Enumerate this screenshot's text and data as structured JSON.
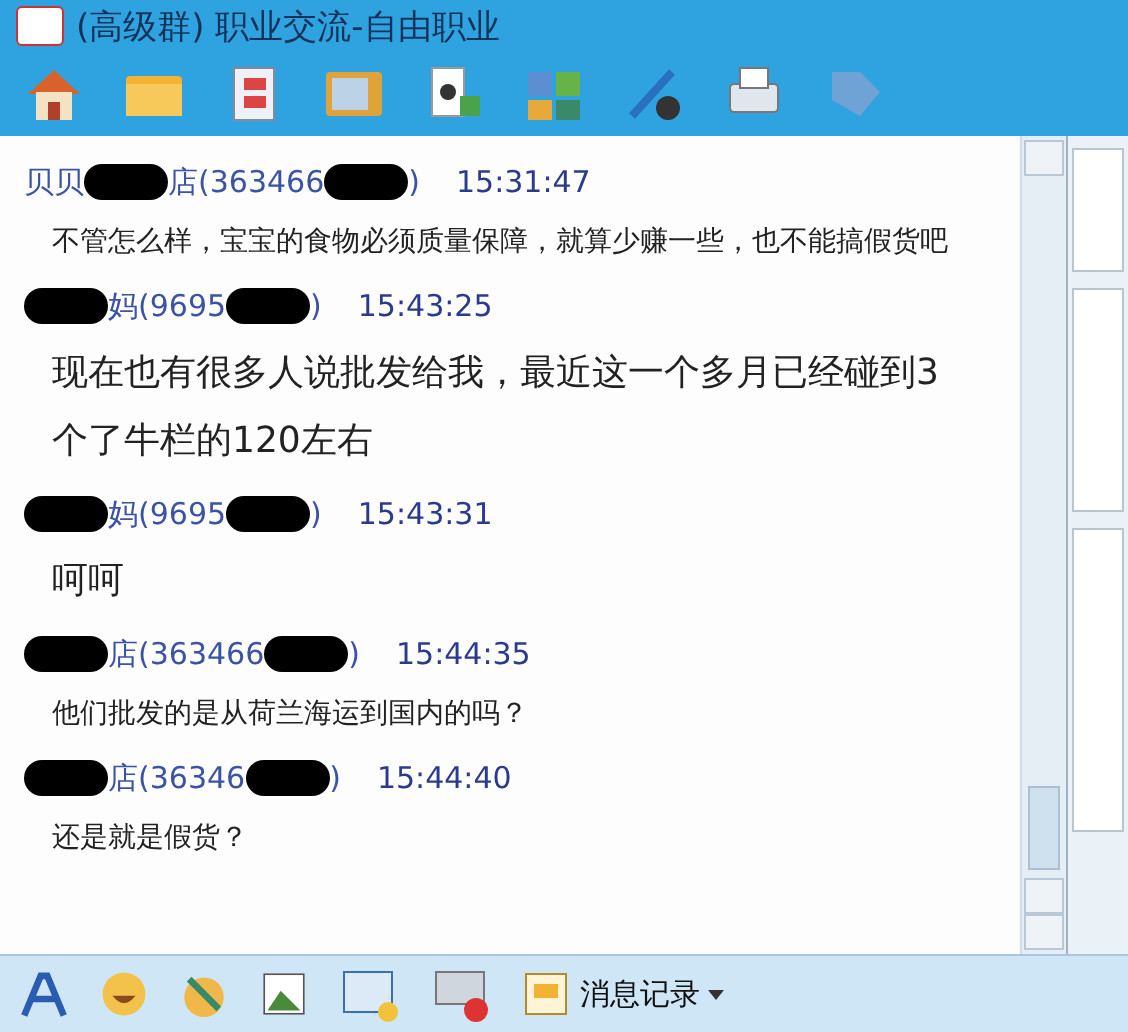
{
  "window": {
    "title": "(高级群) 职业交流-自由职业"
  },
  "messages": [
    {
      "sender": [
        {
          "kind": "text",
          "text": "贝贝"
        },
        {
          "kind": "redaction"
        },
        {
          "kind": "text",
          "text": "店(363466"
        },
        {
          "kind": "redaction"
        },
        {
          "kind": "text",
          "text": ")"
        }
      ],
      "time": "15:31:47",
      "text": "不管怎么样，宝宝的食物必须质量保障，就算少赚一些，也不能搞假货吧",
      "kind": "normal"
    },
    {
      "sender": [
        {
          "kind": "redaction"
        },
        {
          "kind": "text",
          "text": "妈(9695"
        },
        {
          "kind": "redaction"
        },
        {
          "kind": "text",
          "text": ")"
        }
      ],
      "time": "15:43:25",
      "text": "现在也有很多人说批发给我，最近这一个多月已经碰到3个了牛栏的120左右",
      "kind": "large"
    },
    {
      "sender": [
        {
          "kind": "redaction"
        },
        {
          "kind": "text",
          "text": "妈(9695"
        },
        {
          "kind": "redaction"
        },
        {
          "kind": "text",
          "text": ")"
        }
      ],
      "time": "15:43:31",
      "text": "呵呵",
      "kind": "large"
    },
    {
      "sender": [
        {
          "kind": "redaction"
        },
        {
          "kind": "text",
          "text": "店(363466"
        },
        {
          "kind": "redaction"
        },
        {
          "kind": "text",
          "text": ")"
        }
      ],
      "time": "15:44:35",
      "text": "他们批发的是从荷兰海运到国内的吗？",
      "kind": "normal"
    },
    {
      "sender": [
        {
          "kind": "redaction"
        },
        {
          "kind": "text",
          "text": "店(36346"
        },
        {
          "kind": "redaction"
        },
        {
          "kind": "text",
          "text": ")"
        }
      ],
      "time": "15:44:40",
      "text": "还是就是假货？",
      "kind": "normal"
    }
  ],
  "input_toolbar": {
    "history_button": "消息记录"
  }
}
